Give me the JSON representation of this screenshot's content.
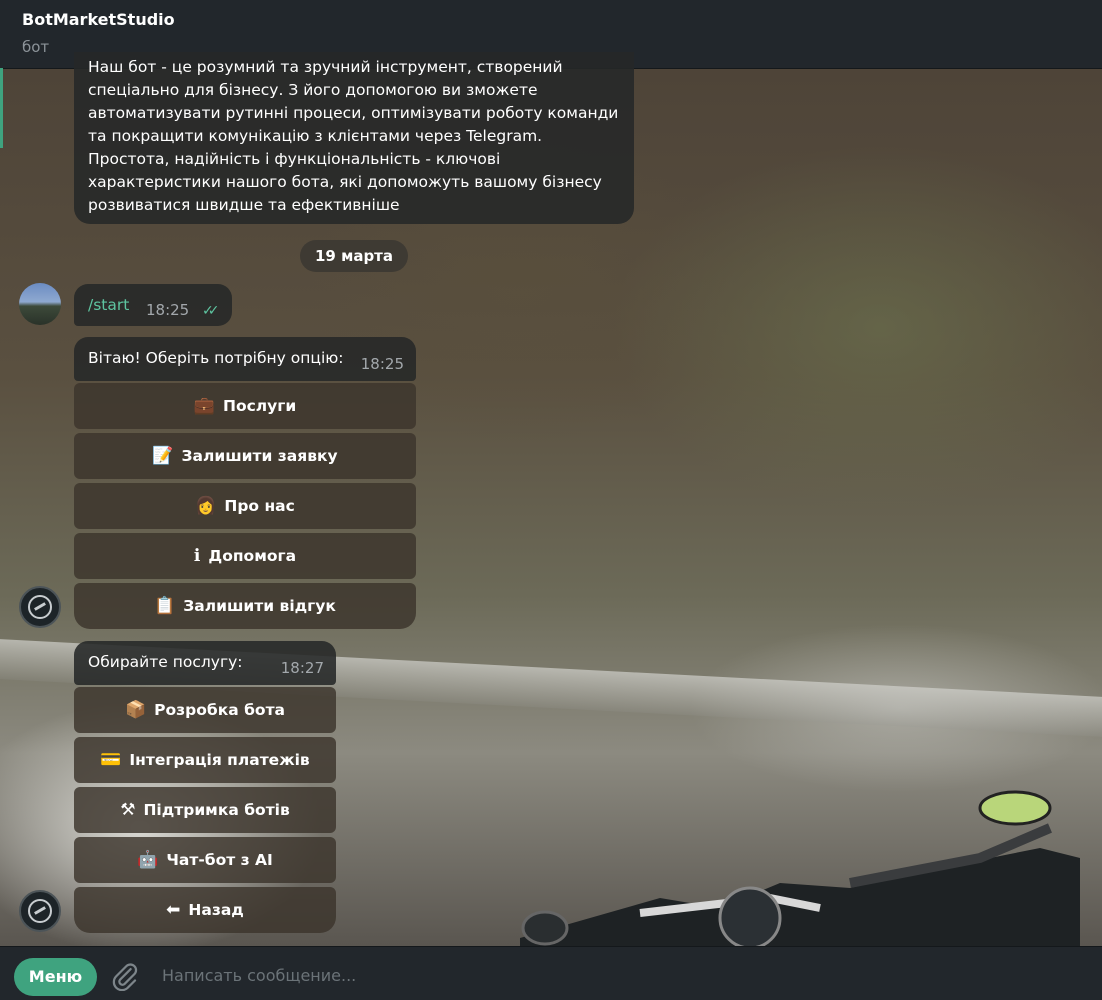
{
  "header": {
    "title": "BotMarketStudio",
    "subtitle": "бот"
  },
  "chat": {
    "intro_message": "Наш бот - це розумний та зручний інструмент, створений спеціально для бізнесу. З його допомогою ви зможете автоматизувати рутинні процеси, оптимізувати роботу команди та покращити комунікацію з клієнтами через Telegram. Простота, надійність і функціональність - ключові характеристики нашого бота, які допоможуть вашому бізнесу розвиватися швидше та ефективніше",
    "date_separator": "19 марта",
    "user_message": {
      "text": "/start",
      "time": "18:25",
      "status_icon": "double-check-icon"
    },
    "bot_menu": {
      "text": "Вітаю! Оберіть потрібну опцію:",
      "time": "18:25",
      "buttons": [
        {
          "emoji": "💼",
          "label": "Послуги"
        },
        {
          "emoji": "📝",
          "label": "Залишити заявку"
        },
        {
          "emoji": "👩",
          "label": "Про нас"
        },
        {
          "emoji": "ℹ",
          "label": "Допомога"
        },
        {
          "emoji": "📋",
          "label": "Залишити відгук"
        }
      ]
    },
    "services_menu": {
      "text": "Обирайте послугу:",
      "time": "18:27",
      "buttons": [
        {
          "emoji": "📦",
          "label": "Розробка бота"
        },
        {
          "emoji": "💳",
          "label": "Інтеграція платежів"
        },
        {
          "emoji": "⚒",
          "label": "Підтримка ботів"
        },
        {
          "emoji": "🤖",
          "label": "Чат-бот з AI"
        },
        {
          "emoji": "⬅",
          "label": "Назад"
        }
      ]
    }
  },
  "input": {
    "menu_label": "Меню",
    "placeholder": "Написать сообщение..."
  },
  "colors": {
    "accent": "#3fa37f",
    "header_bg": "#22272c",
    "link_green": "#5ec4a0"
  }
}
